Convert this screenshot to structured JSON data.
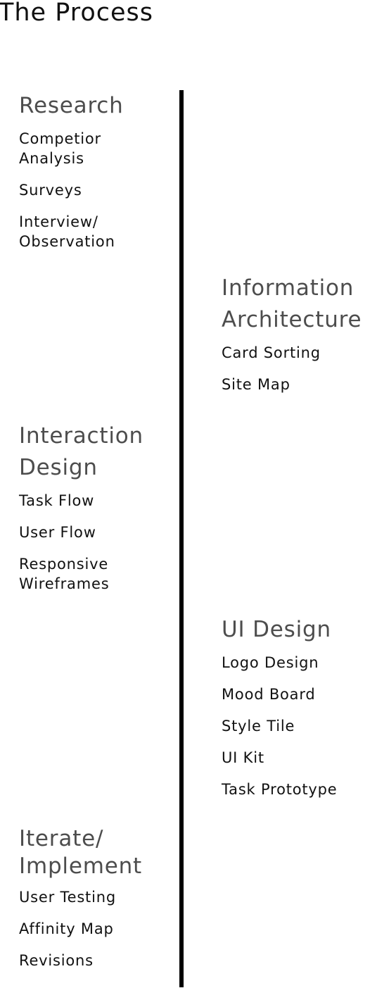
{
  "page": {
    "title": "The Process"
  },
  "sections": [
    {
      "title": "Research",
      "items": [
        "Competior\nAnalysis",
        "Surveys",
        "Interview/\nObservation"
      ]
    },
    {
      "title": "Information\nArchitecture",
      "items": [
        "Card Sorting",
        "Site Map"
      ]
    },
    {
      "title": "Interaction\nDesign",
      "items": [
        "Task Flow",
        "User Flow",
        "Responsive\nWireframes"
      ]
    },
    {
      "title": "UI Design",
      "items": [
        "Logo Design",
        "Mood Board",
        "Style Tile",
        "UI Kit",
        "Task Prototype"
      ]
    },
    {
      "title": "Iterate/\nImplement",
      "items": [
        "User Testing",
        "Affinity Map",
        "Revisions"
      ]
    }
  ],
  "colors": {
    "title": "#111111",
    "section_heading": "#4d4d4d",
    "item_text": "#111111",
    "timeline": "#000000",
    "background": "#ffffff"
  }
}
